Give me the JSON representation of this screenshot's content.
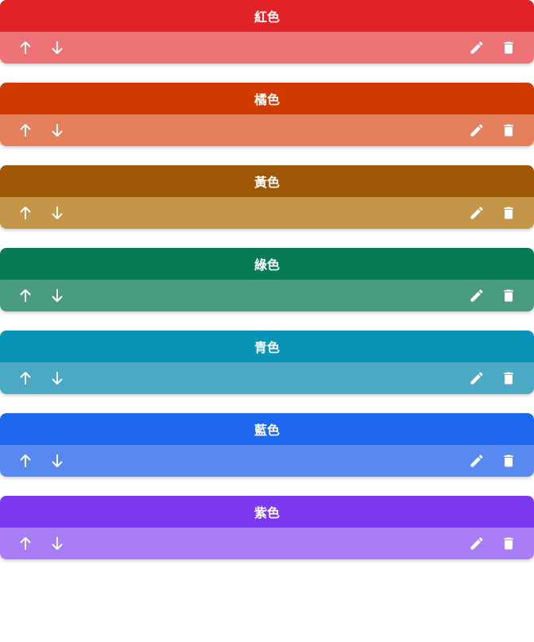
{
  "items": [
    {
      "label": "紅色",
      "title_color": "#E22328",
      "bar_color": "#EE7376"
    },
    {
      "label": "橘色",
      "title_color": "#CF3A00",
      "bar_color": "#E4805C"
    },
    {
      "label": "黃色",
      "title_color": "#9E5607",
      "bar_color": "#C4964A"
    },
    {
      "label": "綠色",
      "title_color": "#087B53",
      "bar_color": "#4A9C7E"
    },
    {
      "label": "青色",
      "title_color": "#0993B7",
      "bar_color": "#4BA9C3"
    },
    {
      "label": "藍色",
      "title_color": "#1E68EF",
      "bar_color": "#5789F0"
    },
    {
      "label": "紫色",
      "title_color": "#7C39F1",
      "bar_color": "#A87DF6"
    }
  ],
  "icons": {
    "move_up": "arrow-up-icon",
    "move_down": "arrow-down-icon",
    "edit": "pencil-icon",
    "delete": "trash-icon"
  }
}
